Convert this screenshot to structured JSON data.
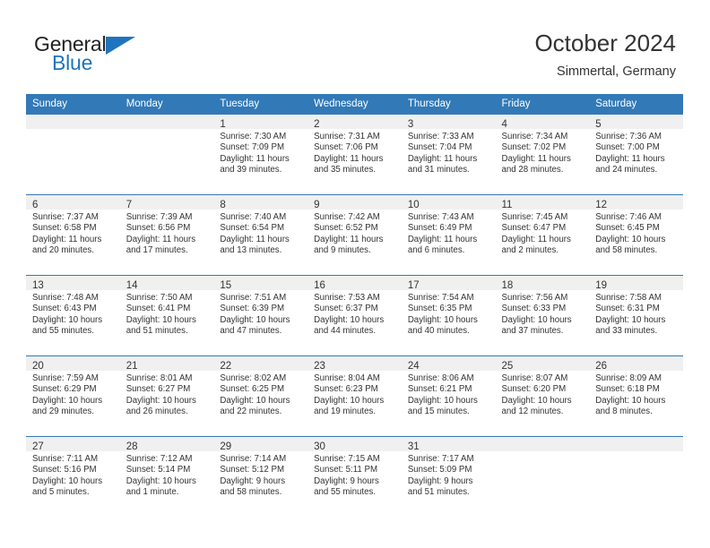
{
  "brand": {
    "name_part1": "General",
    "name_part2": "Blue",
    "triangle_color": "#1f74bd"
  },
  "header": {
    "title": "October 2024",
    "subtitle": "Simmertal, Germany"
  },
  "theme": {
    "header_bar_color": "#3279b7",
    "datebar_color": "#f0f0f0",
    "row_separator_color": "#3279b7",
    "text_color": "#333333"
  },
  "weekday_headers": [
    "Sunday",
    "Monday",
    "Tuesday",
    "Wednesday",
    "Thursday",
    "Friday",
    "Saturday"
  ],
  "weeks": [
    [
      {
        "day": "",
        "sunrise": "",
        "sunset": "",
        "daylight_line1": "",
        "daylight_line2": ""
      },
      {
        "day": "",
        "sunrise": "",
        "sunset": "",
        "daylight_line1": "",
        "daylight_line2": ""
      },
      {
        "day": "1",
        "sunrise": "Sunrise: 7:30 AM",
        "sunset": "Sunset: 7:09 PM",
        "daylight_line1": "Daylight: 11 hours",
        "daylight_line2": "and 39 minutes."
      },
      {
        "day": "2",
        "sunrise": "Sunrise: 7:31 AM",
        "sunset": "Sunset: 7:06 PM",
        "daylight_line1": "Daylight: 11 hours",
        "daylight_line2": "and 35 minutes."
      },
      {
        "day": "3",
        "sunrise": "Sunrise: 7:33 AM",
        "sunset": "Sunset: 7:04 PM",
        "daylight_line1": "Daylight: 11 hours",
        "daylight_line2": "and 31 minutes."
      },
      {
        "day": "4",
        "sunrise": "Sunrise: 7:34 AM",
        "sunset": "Sunset: 7:02 PM",
        "daylight_line1": "Daylight: 11 hours",
        "daylight_line2": "and 28 minutes."
      },
      {
        "day": "5",
        "sunrise": "Sunrise: 7:36 AM",
        "sunset": "Sunset: 7:00 PM",
        "daylight_line1": "Daylight: 11 hours",
        "daylight_line2": "and 24 minutes."
      }
    ],
    [
      {
        "day": "6",
        "sunrise": "Sunrise: 7:37 AM",
        "sunset": "Sunset: 6:58 PM",
        "daylight_line1": "Daylight: 11 hours",
        "daylight_line2": "and 20 minutes."
      },
      {
        "day": "7",
        "sunrise": "Sunrise: 7:39 AM",
        "sunset": "Sunset: 6:56 PM",
        "daylight_line1": "Daylight: 11 hours",
        "daylight_line2": "and 17 minutes."
      },
      {
        "day": "8",
        "sunrise": "Sunrise: 7:40 AM",
        "sunset": "Sunset: 6:54 PM",
        "daylight_line1": "Daylight: 11 hours",
        "daylight_line2": "and 13 minutes."
      },
      {
        "day": "9",
        "sunrise": "Sunrise: 7:42 AM",
        "sunset": "Sunset: 6:52 PM",
        "daylight_line1": "Daylight: 11 hours",
        "daylight_line2": "and 9 minutes."
      },
      {
        "day": "10",
        "sunrise": "Sunrise: 7:43 AM",
        "sunset": "Sunset: 6:49 PM",
        "daylight_line1": "Daylight: 11 hours",
        "daylight_line2": "and 6 minutes."
      },
      {
        "day": "11",
        "sunrise": "Sunrise: 7:45 AM",
        "sunset": "Sunset: 6:47 PM",
        "daylight_line1": "Daylight: 11 hours",
        "daylight_line2": "and 2 minutes."
      },
      {
        "day": "12",
        "sunrise": "Sunrise: 7:46 AM",
        "sunset": "Sunset: 6:45 PM",
        "daylight_line1": "Daylight: 10 hours",
        "daylight_line2": "and 58 minutes."
      }
    ],
    [
      {
        "day": "13",
        "sunrise": "Sunrise: 7:48 AM",
        "sunset": "Sunset: 6:43 PM",
        "daylight_line1": "Daylight: 10 hours",
        "daylight_line2": "and 55 minutes."
      },
      {
        "day": "14",
        "sunrise": "Sunrise: 7:50 AM",
        "sunset": "Sunset: 6:41 PM",
        "daylight_line1": "Daylight: 10 hours",
        "daylight_line2": "and 51 minutes."
      },
      {
        "day": "15",
        "sunrise": "Sunrise: 7:51 AM",
        "sunset": "Sunset: 6:39 PM",
        "daylight_line1": "Daylight: 10 hours",
        "daylight_line2": "and 47 minutes."
      },
      {
        "day": "16",
        "sunrise": "Sunrise: 7:53 AM",
        "sunset": "Sunset: 6:37 PM",
        "daylight_line1": "Daylight: 10 hours",
        "daylight_line2": "and 44 minutes."
      },
      {
        "day": "17",
        "sunrise": "Sunrise: 7:54 AM",
        "sunset": "Sunset: 6:35 PM",
        "daylight_line1": "Daylight: 10 hours",
        "daylight_line2": "and 40 minutes."
      },
      {
        "day": "18",
        "sunrise": "Sunrise: 7:56 AM",
        "sunset": "Sunset: 6:33 PM",
        "daylight_line1": "Daylight: 10 hours",
        "daylight_line2": "and 37 minutes."
      },
      {
        "day": "19",
        "sunrise": "Sunrise: 7:58 AM",
        "sunset": "Sunset: 6:31 PM",
        "daylight_line1": "Daylight: 10 hours",
        "daylight_line2": "and 33 minutes."
      }
    ],
    [
      {
        "day": "20",
        "sunrise": "Sunrise: 7:59 AM",
        "sunset": "Sunset: 6:29 PM",
        "daylight_line1": "Daylight: 10 hours",
        "daylight_line2": "and 29 minutes."
      },
      {
        "day": "21",
        "sunrise": "Sunrise: 8:01 AM",
        "sunset": "Sunset: 6:27 PM",
        "daylight_line1": "Daylight: 10 hours",
        "daylight_line2": "and 26 minutes."
      },
      {
        "day": "22",
        "sunrise": "Sunrise: 8:02 AM",
        "sunset": "Sunset: 6:25 PM",
        "daylight_line1": "Daylight: 10 hours",
        "daylight_line2": "and 22 minutes."
      },
      {
        "day": "23",
        "sunrise": "Sunrise: 8:04 AM",
        "sunset": "Sunset: 6:23 PM",
        "daylight_line1": "Daylight: 10 hours",
        "daylight_line2": "and 19 minutes."
      },
      {
        "day": "24",
        "sunrise": "Sunrise: 8:06 AM",
        "sunset": "Sunset: 6:21 PM",
        "daylight_line1": "Daylight: 10 hours",
        "daylight_line2": "and 15 minutes."
      },
      {
        "day": "25",
        "sunrise": "Sunrise: 8:07 AM",
        "sunset": "Sunset: 6:20 PM",
        "daylight_line1": "Daylight: 10 hours",
        "daylight_line2": "and 12 minutes."
      },
      {
        "day": "26",
        "sunrise": "Sunrise: 8:09 AM",
        "sunset": "Sunset: 6:18 PM",
        "daylight_line1": "Daylight: 10 hours",
        "daylight_line2": "and 8 minutes."
      }
    ],
    [
      {
        "day": "27",
        "sunrise": "Sunrise: 7:11 AM",
        "sunset": "Sunset: 5:16 PM",
        "daylight_line1": "Daylight: 10 hours",
        "daylight_line2": "and 5 minutes."
      },
      {
        "day": "28",
        "sunrise": "Sunrise: 7:12 AM",
        "sunset": "Sunset: 5:14 PM",
        "daylight_line1": "Daylight: 10 hours",
        "daylight_line2": "and 1 minute."
      },
      {
        "day": "29",
        "sunrise": "Sunrise: 7:14 AM",
        "sunset": "Sunset: 5:12 PM",
        "daylight_line1": "Daylight: 9 hours",
        "daylight_line2": "and 58 minutes."
      },
      {
        "day": "30",
        "sunrise": "Sunrise: 7:15 AM",
        "sunset": "Sunset: 5:11 PM",
        "daylight_line1": "Daylight: 9 hours",
        "daylight_line2": "and 55 minutes."
      },
      {
        "day": "31",
        "sunrise": "Sunrise: 7:17 AM",
        "sunset": "Sunset: 5:09 PM",
        "daylight_line1": "Daylight: 9 hours",
        "daylight_line2": "and 51 minutes."
      },
      {
        "day": "",
        "sunrise": "",
        "sunset": "",
        "daylight_line1": "",
        "daylight_line2": ""
      },
      {
        "day": "",
        "sunrise": "",
        "sunset": "",
        "daylight_line1": "",
        "daylight_line2": ""
      }
    ]
  ]
}
